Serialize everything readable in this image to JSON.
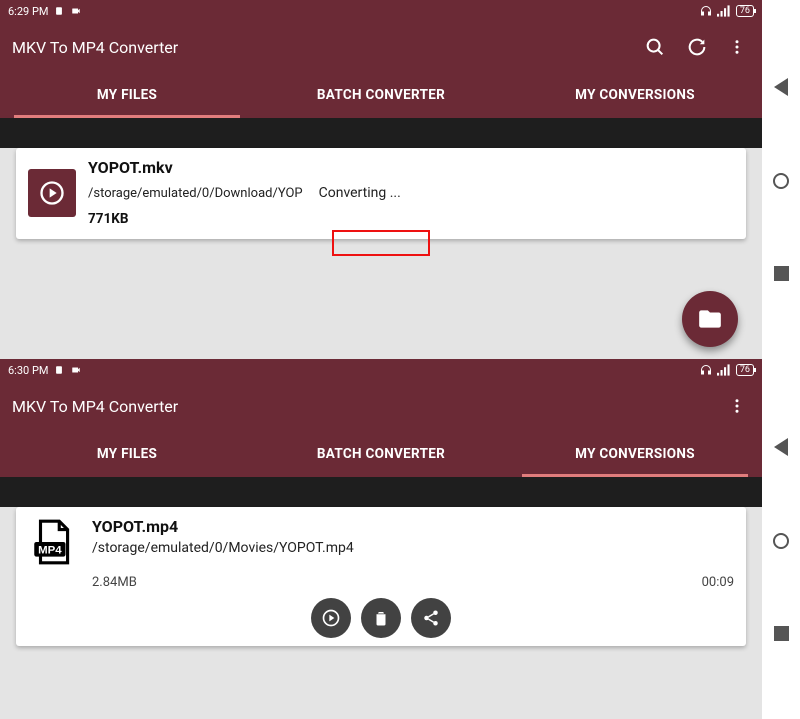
{
  "screens": [
    {
      "status": {
        "time": "6:29 PM",
        "battery": "76"
      },
      "app_title": "MKV To MP4 Converter",
      "has_search": true,
      "has_refresh": true,
      "tabs": [
        "MY FILES",
        "BATCH CONVERTER",
        "MY CONVERSIONS"
      ],
      "active_tab": 0,
      "file": {
        "name": "YOPOT.mkv",
        "path": "/storage/emulated/0/Download/YOP",
        "status": "Converting ...",
        "size": "771KB"
      }
    },
    {
      "status": {
        "time": "6:30 PM",
        "battery": "76"
      },
      "app_title": "MKV To MP4 Converter",
      "has_search": false,
      "has_refresh": false,
      "tabs": [
        "MY FILES",
        "BATCH CONVERTER",
        "MY CONVERSIONS"
      ],
      "active_tab": 2,
      "file": {
        "name": "YOPOT.mp4",
        "path": "/storage/emulated/0/Movies/YOPOT.mp4",
        "size": "2.84MB",
        "duration": "00:09"
      }
    }
  ]
}
